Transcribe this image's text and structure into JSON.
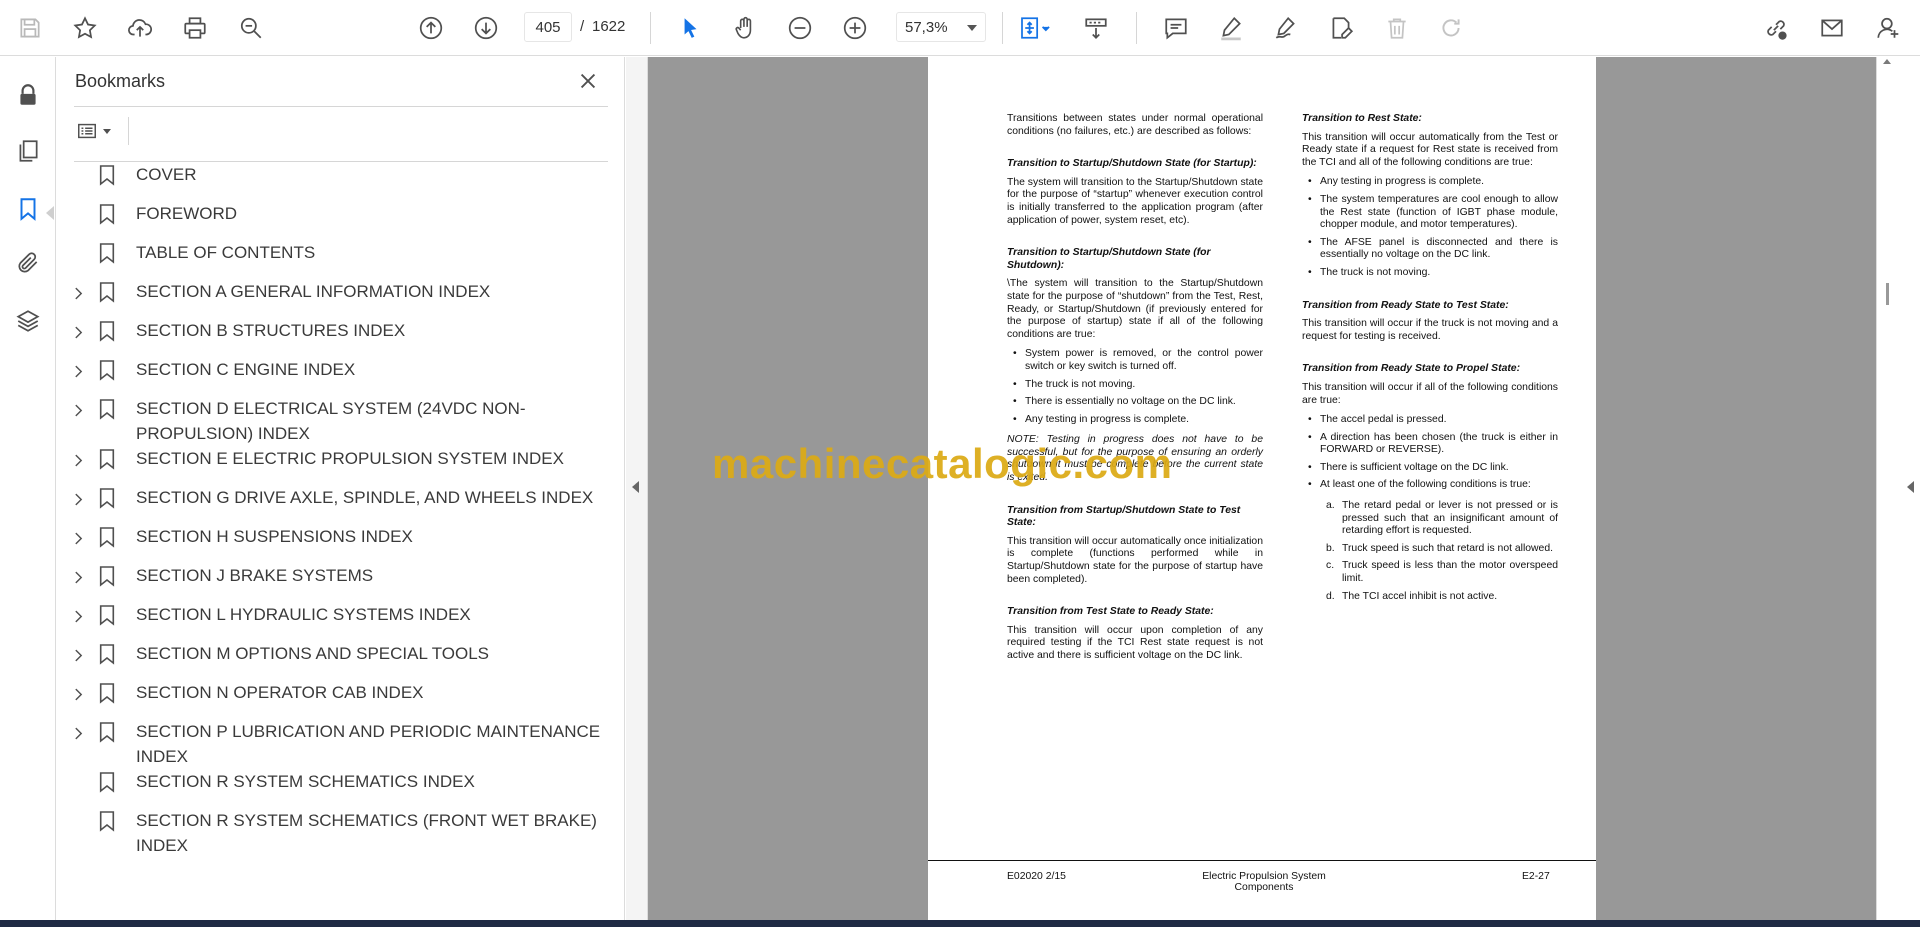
{
  "toolbar": {
    "current_page": "405",
    "page_separator": "/",
    "total_pages": "1622",
    "zoom": "57,3%"
  },
  "panel": {
    "title": "Bookmarks",
    "bookmarks": [
      {
        "label": "COVER",
        "expandable": false
      },
      {
        "label": "FOREWORD",
        "expandable": false
      },
      {
        "label": "TABLE OF CONTENTS",
        "expandable": false
      },
      {
        "label": "SECTION A GENERAL INFORMATION INDEX",
        "expandable": true
      },
      {
        "label": "SECTION B STRUCTURES INDEX",
        "expandable": true
      },
      {
        "label": "SECTION C ENGINE INDEX",
        "expandable": true
      },
      {
        "label": "SECTION D ELECTRICAL SYSTEM (24VDC NON-PROPULSION) INDEX",
        "expandable": true
      },
      {
        "label": "SECTION E ELECTRIC PROPULSION SYSTEM INDEX",
        "expandable": true
      },
      {
        "label": "SECTION G DRIVE AXLE, SPINDLE, AND WHEELS INDEX",
        "expandable": true
      },
      {
        "label": "SECTION H SUSPENSIONS INDEX",
        "expandable": true
      },
      {
        "label": "SECTION J BRAKE SYSTEMS",
        "expandable": true
      },
      {
        "label": "SECTION L HYDRAULIC SYSTEMS INDEX",
        "expandable": true
      },
      {
        "label": "SECTION M OPTIONS AND SPECIAL TOOLS",
        "expandable": true
      },
      {
        "label": "SECTION N OPERATOR CAB INDEX",
        "expandable": true
      },
      {
        "label": "SECTION P LUBRICATION AND PERIODIC MAINTENANCE INDEX",
        "expandable": true
      },
      {
        "label": "SECTION R SYSTEM SCHEMATICS INDEX",
        "expandable": false
      },
      {
        "label": "SECTION R SYSTEM SCHEMATICS (FRONT WET BRAKE) INDEX",
        "expandable": false
      }
    ]
  },
  "document": {
    "left": {
      "intro": "Transitions between states under normal operational conditions (no failures, etc.) are described as follows:",
      "h1": "Transition to Startup/Shutdown State (for Startup):",
      "p1": "The system will transition to the Startup/Shutdown state for the purpose of “startup” whenever execution control is initially transferred to the application program (after application of power, system reset, etc).",
      "h2": "Transition to Startup/Shutdown State (for Shutdown):",
      "p2": "\\The system will transition to the Startup/Shutdown state for the purpose of “shutdown” from the Test, Rest, Ready, or Startup/Shutdown (if previously entered for the purpose of startup) state if all of the following conditions are true:",
      "bullets2": [
        "System power is removed, or the control power switch or key switch is turned off.",
        "The truck is not moving.",
        "There is essentially no voltage on the DC link.",
        "Any testing in progress is complete."
      ],
      "note": "NOTE: Testing in progress does not have to be successful, but for the purpose of ensuring an orderly shutdown it must be complete before the current state is exited.",
      "h3": "Transition from Startup/Shutdown State to Test State:",
      "p3": "This transition will occur automatically once initialization is complete (functions performed while in Startup/Shutdown state for the purpose of startup have been completed).",
      "h4": "Transition from Test State to Ready State:",
      "p4": "This transition will occur upon completion of any required testing if the TCI Rest state request is not active and there is sufficient voltage on the DC link."
    },
    "right": {
      "h1": "Transition to Rest State:",
      "p1": "This transition will occur automatically from the Test or Ready state if a request for Rest state is received from the TCI and all of the following conditions are true:",
      "bullets1": [
        "Any testing in progress is complete.",
        "The system temperatures are cool enough to allow the Rest state (function of IGBT phase module, chopper module, and motor temperatures).",
        "The AFSE panel is disconnected and there is essentially no voltage on the DC link.",
        "The truck is not moving."
      ],
      "h2": "Transition from Ready State to Test State:",
      "p2": "This transition will occur if the truck is not moving and a request for testing is received.",
      "h3": "Transition from Ready State to Propel State:",
      "p3": "This transition will occur if all of the following conditions are true:",
      "bullets3": [
        "The accel pedal is pressed.",
        "A direction has been chosen (the truck is either in FORWARD or REVERSE).",
        "There is sufficient voltage on the DC link.",
        "At least one of the following conditions is true:"
      ],
      "sub": [
        {
          "mark": "a.",
          "text": "The retard pedal or lever is not pressed or is pressed such that an insignificant amount of retarding effort is requested."
        },
        {
          "mark": "b.",
          "text": "Truck speed is such that retard is not allowed."
        },
        {
          "mark": "c.",
          "text": "Truck speed is less than the motor overspeed limit."
        },
        {
          "mark": "d.",
          "text": "The TCI accel inhibit is not active."
        }
      ]
    },
    "footer": {
      "code": "E02020   2/15",
      "title": "Electric Propulsion System Components",
      "page": "E2-27"
    },
    "watermark": "machinecatalogic.com"
  },
  "colors": {
    "accent_blue": "#1473e6",
    "doc_background": "#989898",
    "watermark": "#dcaa14"
  }
}
